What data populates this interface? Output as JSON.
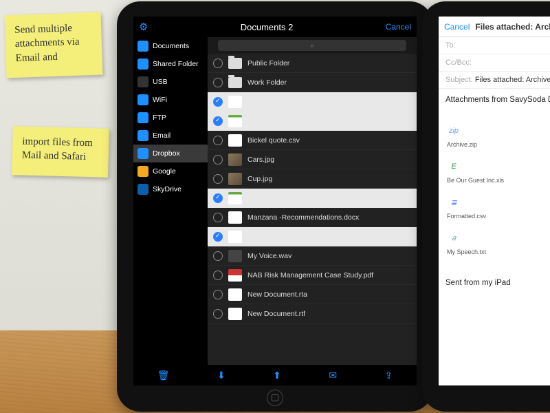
{
  "sticky1": "Send multiple attachments via Email and",
  "sticky2": "import files from Mail and Safari",
  "header": {
    "title": "Documents 2",
    "cancel": "Cancel"
  },
  "sidebar": {
    "items": [
      {
        "label": "Documents",
        "color": "#1e90ff"
      },
      {
        "label": "Shared Folder",
        "color": "#1e90ff"
      },
      {
        "label": "USB",
        "color": "#333"
      },
      {
        "label": "WiFi",
        "color": "#1e90ff"
      },
      {
        "label": "FTP",
        "color": "#1e90ff"
      },
      {
        "label": "Email",
        "color": "#1e90ff"
      },
      {
        "label": "Dropbox",
        "color": "#1e90ff",
        "selected": true
      },
      {
        "label": "Google",
        "color": "#f5a623"
      },
      {
        "label": "SkyDrive",
        "color": "#0a5faa"
      }
    ]
  },
  "files": [
    {
      "name": "Public Folder",
      "type": "folder",
      "selected": false
    },
    {
      "name": "Work Folder",
      "type": "folder",
      "selected": false
    },
    {
      "name": "",
      "type": "file",
      "selected": true,
      "thumb": "doc"
    },
    {
      "name": "",
      "type": "file",
      "selected": true,
      "thumb": "green"
    },
    {
      "name": "Bickel quote.csv",
      "type": "file",
      "selected": false,
      "thumb": "doc"
    },
    {
      "name": "Cars.jpg",
      "type": "file",
      "selected": false,
      "thumb": "photo"
    },
    {
      "name": "Cup.jpg",
      "type": "file",
      "selected": false,
      "thumb": "photo"
    },
    {
      "name": "",
      "type": "file",
      "selected": true,
      "thumb": "green"
    },
    {
      "name": "Manzana -Recommendations.docx",
      "type": "file",
      "selected": false,
      "thumb": "doc"
    },
    {
      "name": "",
      "type": "file",
      "selected": true,
      "thumb": "doc"
    },
    {
      "name": "My Voice.wav",
      "type": "file",
      "selected": false,
      "thumb": "dark"
    },
    {
      "name": "NAB Risk Management Case Study.pdf",
      "type": "file",
      "selected": false,
      "thumb": "red"
    },
    {
      "name": "New Document.rta",
      "type": "file",
      "selected": false,
      "thumb": "doc"
    },
    {
      "name": "New Document.rtf",
      "type": "file",
      "selected": false,
      "thumb": "doc"
    }
  ],
  "mail": {
    "cancel": "Cancel",
    "title": "Files attached:  Archive.zip Be Our Gues",
    "to": "To:",
    "cc": "Cc/Bcc:",
    "subject_label": "Subject:",
    "subject": "Files attached:  Archive.zip Be Our Guest Inc.",
    "body": "Attachments from SavySoda Documents for iOS.",
    "attachments": [
      {
        "name": "Archive.zip",
        "glyph": "zip",
        "color": "#6aa2ff"
      },
      {
        "name": "Be Our Guest Inc.xls",
        "glyph": "E",
        "color": "#3a9a4a"
      },
      {
        "name": "Formatted.csv",
        "glyph": "≣",
        "color": "#4a7aff"
      },
      {
        "name": "My Speech.txt",
        "glyph": "𝑎",
        "color": "#7aa"
      }
    ],
    "signature": "Sent from my iPad"
  }
}
